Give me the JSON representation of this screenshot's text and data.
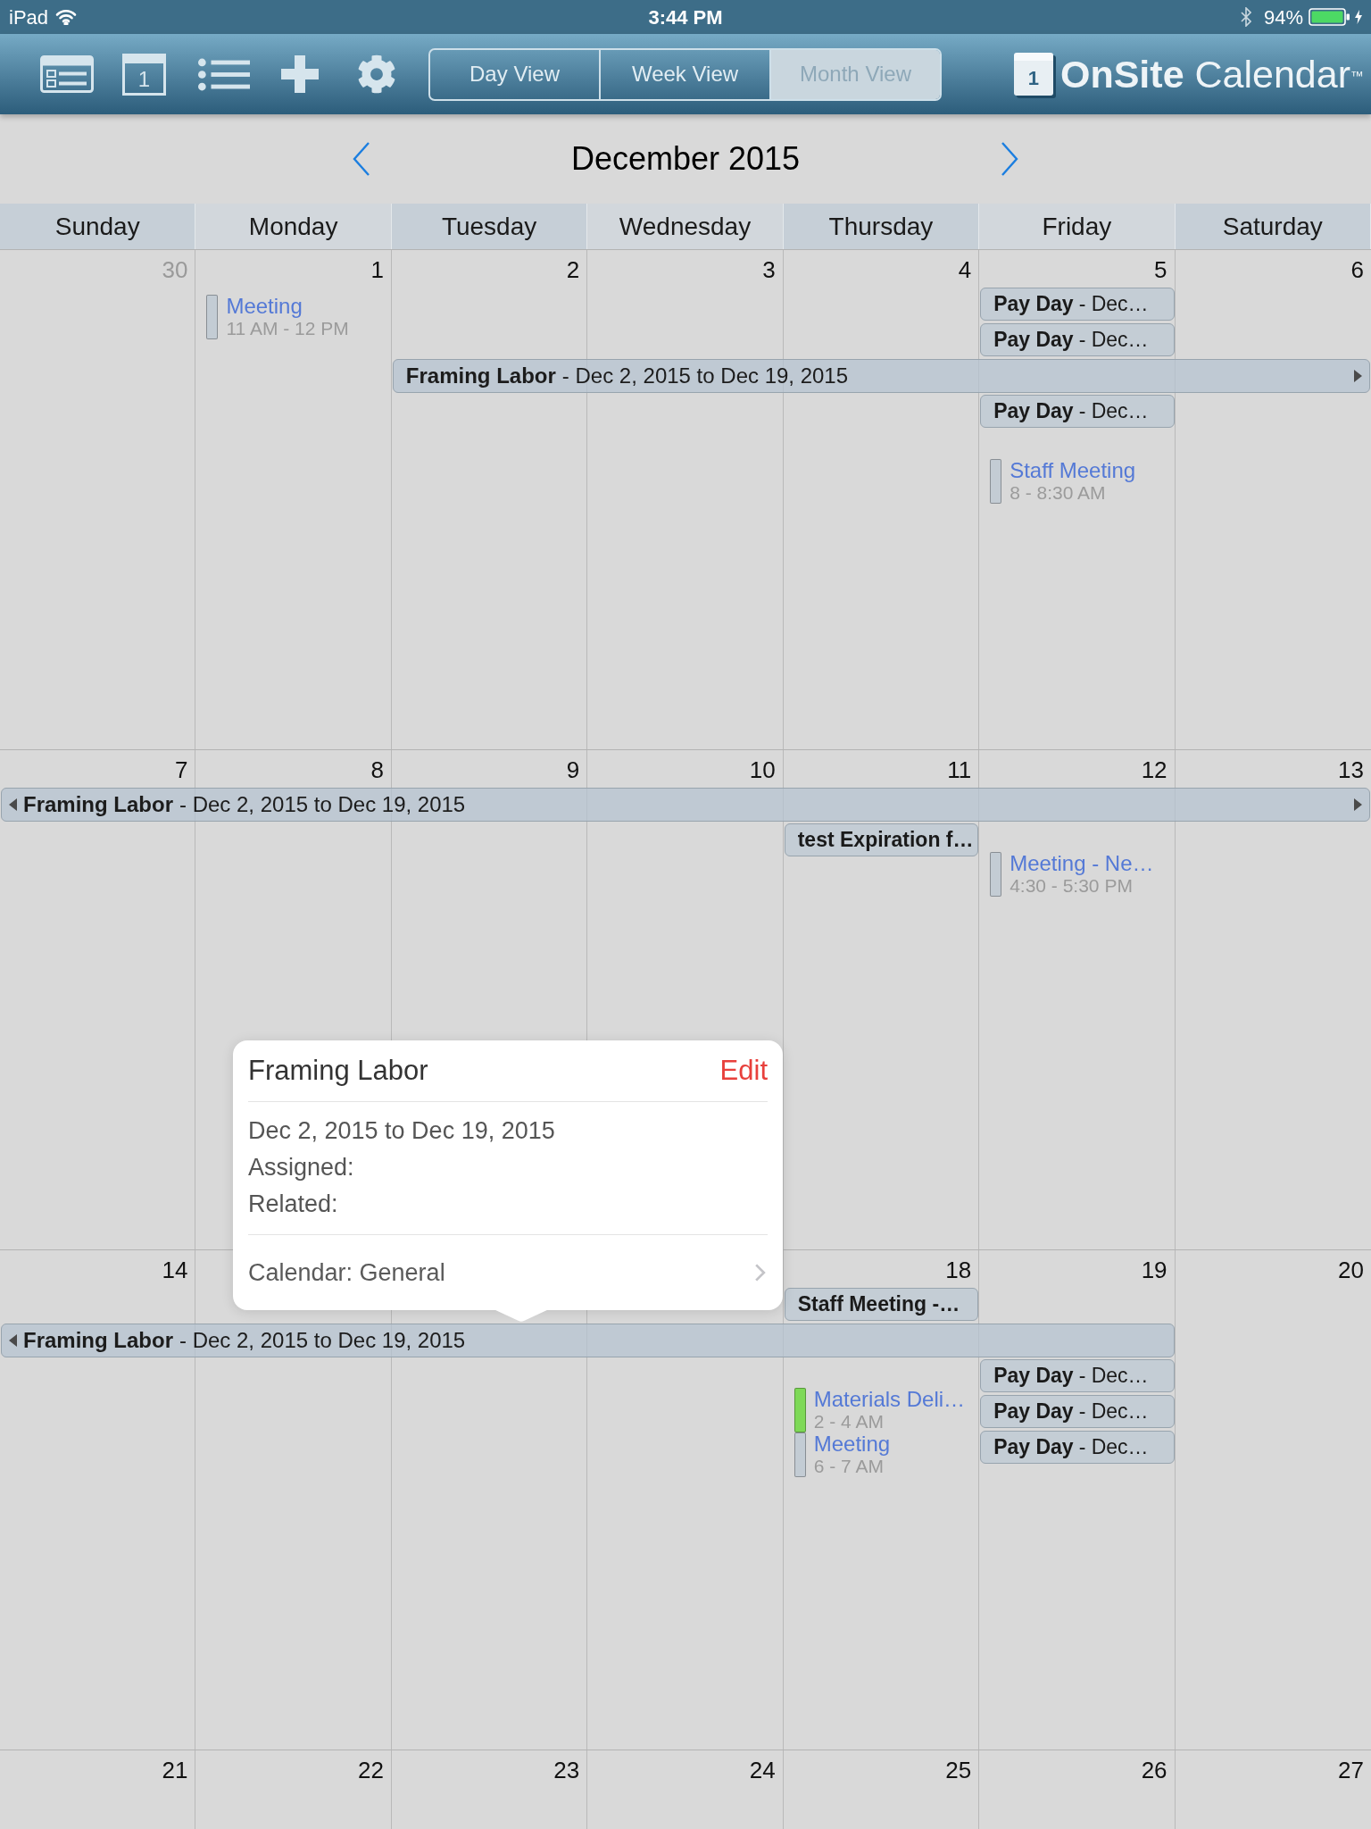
{
  "status_bar": {
    "carrier": "iPad",
    "time": "3:44 PM",
    "battery": "94%"
  },
  "toolbar": {
    "tools": [
      {
        "kind": "cards"
      },
      {
        "kind": "today",
        "label": "1"
      },
      {
        "kind": "list"
      },
      {
        "kind": "add"
      },
      {
        "kind": "settings"
      }
    ],
    "views": [
      {
        "label": "Day View",
        "selected": false
      },
      {
        "label": "Week View",
        "selected": false
      },
      {
        "label": "Month View",
        "selected": true
      }
    ],
    "logo": {
      "badge": "1",
      "text": "**OnSite** Calendar$^{™}$"
    }
  },
  "month_nav": {
    "title": "December 2015"
  },
  "day_headers": [
    "Sunday",
    "Monday",
    "Tuesday",
    "Wednesday",
    "Thursday",
    "Friday",
    "Saturday"
  ],
  "weeks": [
    {
      "banner": {
        "title": "Framing Labor",
        "detail": "- Dec 2, 2015 to Dec 19, 2015",
        "continues_before": false,
        "continues_after": true
      },
      "days": [
        {
          "number": "30",
          "in_month": false
        },
        {
          "number": "1",
          "in_month": true,
          "events": [
            {
              "title": "Meeting",
              "time": "11 AM - 12 PM",
              "color": "#c3ccd4"
            }
          ]
        },
        {
          "number": "2",
          "in_month": true,
          "all_day": [
            {
              "kind": "banner"
            }
          ]
        },
        {
          "number": "3",
          "in_month": true,
          "all_day": [
            {
              "kind": "banner"
            }
          ]
        },
        {
          "number": "4",
          "in_month": true,
          "all_day": [
            {
              "kind": "banner"
            }
          ]
        },
        {
          "number": "5",
          "in_month": true,
          "all_day": [
            {
              "kind": "chip",
              "title": "Pay Day",
              "detail": "- Dec…"
            },
            {
              "kind": "chip",
              "title": "Pay Day",
              "detail": "- Dec…"
            },
            {
              "kind": "banner"
            },
            {
              "kind": "chip",
              "title": "Pay Day",
              "detail": "- Dec…"
            }
          ],
          "events": [
            {
              "title": "Staff Meeting",
              "time": "8 - 8:30 AM",
              "color": "#c3ccd4"
            }
          ]
        },
        {
          "number": "6",
          "in_month": true,
          "all_day": [
            {
              "kind": "banner"
            }
          ]
        }
      ]
    },
    {
      "banner": {
        "title": "Framing Labor",
        "detail": "- Dec 2, 2015 to Dec 19, 2015",
        "continues_before": true,
        "continues_after": true
      },
      "days": [
        {
          "number": "7",
          "in_month": true,
          "all_day": [
            {
              "kind": "banner"
            }
          ]
        },
        {
          "number": "8",
          "in_month": true,
          "all_day": [
            {
              "kind": "banner"
            }
          ]
        },
        {
          "number": "9",
          "in_month": true,
          "all_day": [
            {
              "kind": "banner"
            }
          ]
        },
        {
          "number": "10",
          "in_month": true,
          "all_day": [
            {
              "kind": "banner"
            }
          ]
        },
        {
          "number": "11",
          "in_month": true,
          "all_day": [
            {
              "kind": "banner"
            },
            {
              "kind": "chip",
              "title": "test Expiration f…"
            }
          ]
        },
        {
          "number": "12",
          "in_month": true,
          "all_day": [
            {
              "kind": "banner"
            }
          ],
          "events": [
            {
              "title": "Meeting - Ne…",
              "time": "4:30 - 5:30 PM",
              "color": "#c3ccd4"
            }
          ]
        },
        {
          "number": "13",
          "in_month": true,
          "all_day": [
            {
              "kind": "banner"
            }
          ]
        }
      ]
    },
    {
      "banner": {
        "title": "Framing Labor",
        "detail": "- Dec 2, 2015 to Dec 19, 2015",
        "continues_before": true,
        "continues_after": false
      },
      "days": [
        {
          "number": "14",
          "in_month": true,
          "all_day": [
            {
              "kind": "banner"
            }
          ]
        },
        {
          "all_day": [
            {
              "kind": "banner"
            }
          ]
        },
        {
          "all_day": [
            {
              "kind": "banner"
            }
          ]
        },
        {
          "all_day": [
            {
              "kind": "banner"
            }
          ]
        },
        {
          "number": "18",
          "in_month": true,
          "all_day": [
            {
              "kind": "chip",
              "title": "Staff Meeting -…"
            },
            {
              "kind": "banner"
            }
          ],
          "events": [
            {
              "title": "Materials Deli…",
              "time": "2 - 4 AM",
              "color": "#7ed957"
            },
            {
              "title": "Meeting",
              "time": "6 - 7 AM",
              "color": "#c3ccd4"
            }
          ]
        },
        {
          "number": "19",
          "in_month": true,
          "all_day": [
            {
              "kind": "banner"
            },
            {
              "kind": "chip",
              "title": "Pay Day",
              "detail": "- Dec…"
            },
            {
              "kind": "chip",
              "title": "Pay Day",
              "detail": "- Dec…"
            },
            {
              "kind": "chip",
              "title": "Pay Day",
              "detail": "- Dec…"
            }
          ]
        },
        {
          "number": "20",
          "in_month": true
        }
      ]
    },
    {
      "days": [
        {
          "number": "21",
          "in_month": true
        },
        {
          "number": "22",
          "in_month": true
        },
        {
          "number": "23",
          "in_month": true
        },
        {
          "number": "24",
          "in_month": true
        },
        {
          "number": "25",
          "in_month": true
        },
        {
          "number": "26",
          "in_month": true
        },
        {
          "number": "27",
          "in_month": true
        }
      ]
    }
  ],
  "popover": {
    "title": "Framing Labor",
    "action": "Edit",
    "lines": [
      "Dec 2, 2015 to Dec 19, 2015",
      "Assigned:",
      "Related:"
    ],
    "calendar": "Calendar: General"
  }
}
